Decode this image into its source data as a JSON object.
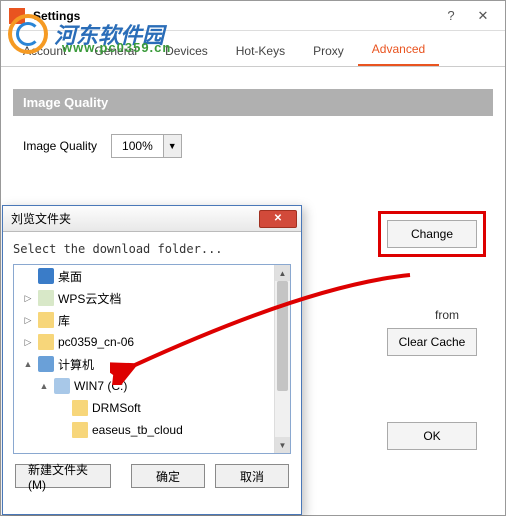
{
  "watermark": {
    "text": "河东软件园",
    "sub": "www.pc0359.cn"
  },
  "settings": {
    "title": "Settings",
    "tabs": [
      "Account",
      "General",
      "Devices",
      "Hot-Keys",
      "Proxy",
      "Advanced"
    ],
    "active_tab": 5,
    "image_quality_header": "Image Quality",
    "image_quality_label": "Image Quality",
    "image_quality_value": "100%",
    "change_btn": "Change",
    "from_text": "from",
    "clear_cache_btn": "Clear Cache",
    "ok_btn": "OK"
  },
  "dialog": {
    "title": "刘览文件夹",
    "message": "Select the download folder...",
    "tree": [
      {
        "level": 1,
        "twisty": "",
        "icon": "desktop",
        "label": "桌面"
      },
      {
        "level": 1,
        "twisty": "▷",
        "icon": "doc",
        "label": "WPS云文档"
      },
      {
        "level": 1,
        "twisty": "▷",
        "icon": "folder",
        "label": "库"
      },
      {
        "level": 1,
        "twisty": "▷",
        "icon": "folder",
        "label": "pc0359_cn-06"
      },
      {
        "level": 1,
        "twisty": "▲",
        "icon": "computer",
        "label": "计算机"
      },
      {
        "level": 2,
        "twisty": "▲",
        "icon": "drive",
        "label": "WIN7 (C:)"
      },
      {
        "level": 3,
        "twisty": "",
        "icon": "folder",
        "label": "DRMSoft"
      },
      {
        "level": 3,
        "twisty": "",
        "icon": "folder",
        "label": "easeus_tb_cloud"
      }
    ],
    "new_folder_btn": "新建文件夹(M)",
    "ok_btn": "确定",
    "cancel_btn": "取消"
  }
}
